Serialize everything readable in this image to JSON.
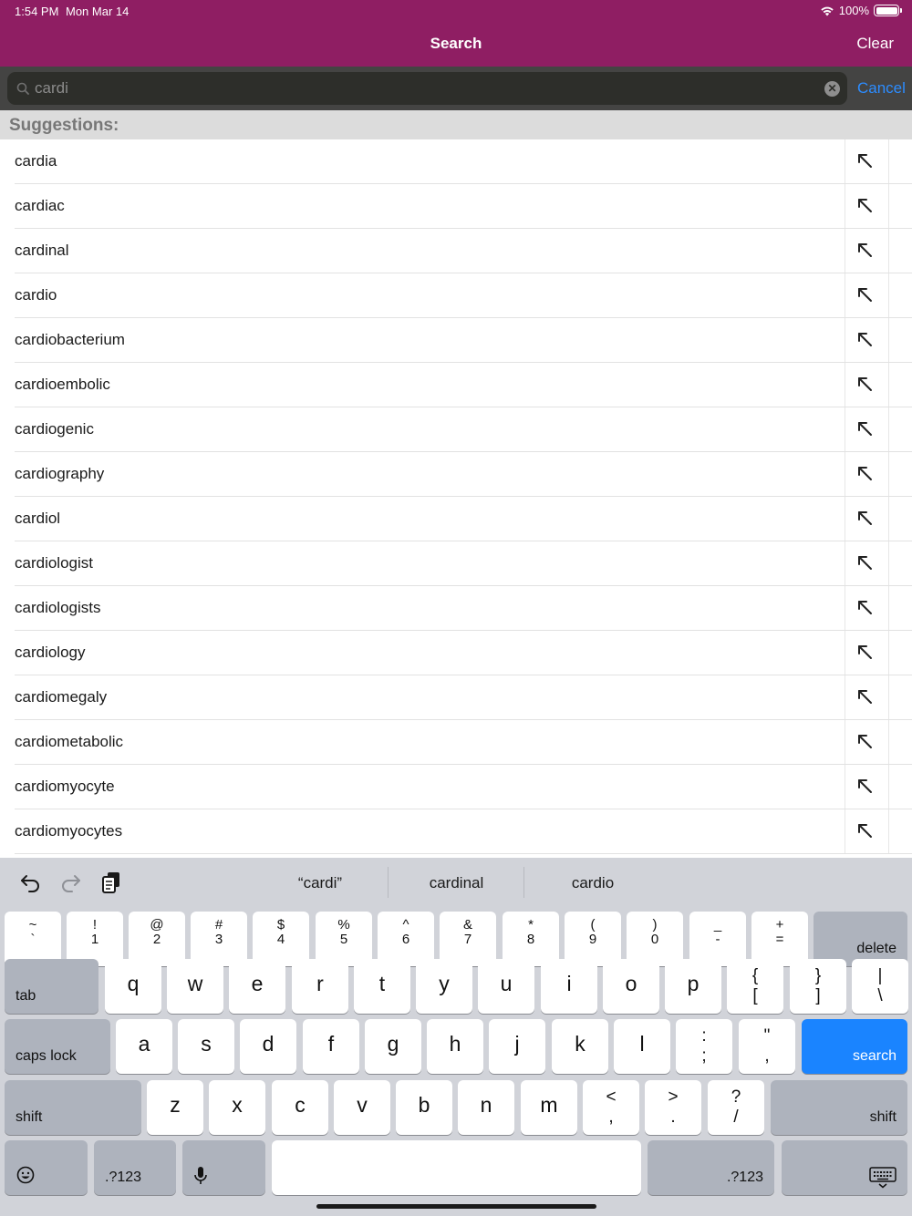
{
  "status": {
    "time": "1:54 PM",
    "date": "Mon Mar 14",
    "battery": "100%"
  },
  "nav": {
    "title": "Search",
    "clear_label": "Clear"
  },
  "search": {
    "value": "cardi",
    "cancel_label": "Cancel"
  },
  "suggestions": {
    "header": "Suggestions:",
    "items": [
      "cardia",
      "cardiac",
      "cardinal",
      "cardio",
      "cardiobacterium",
      "cardioembolic",
      "cardiogenic",
      "cardiography",
      "cardiol",
      "cardiologist",
      "cardiologists",
      "cardiology",
      "cardiomegaly",
      "cardiometabolic",
      "cardiomyocyte",
      "cardiomyocytes"
    ]
  },
  "keyboard": {
    "predictions": [
      "“cardi”",
      "cardinal",
      "cardio"
    ],
    "number_row": [
      {
        "top": "~",
        "bottom": "`"
      },
      {
        "top": "!",
        "bottom": "1"
      },
      {
        "top": "@",
        "bottom": "2"
      },
      {
        "top": "#",
        "bottom": "3"
      },
      {
        "top": "$",
        "bottom": "4"
      },
      {
        "top": "%",
        "bottom": "5"
      },
      {
        "top": "^",
        "bottom": "6"
      },
      {
        "top": "&",
        "bottom": "7"
      },
      {
        "top": "*",
        "bottom": "8"
      },
      {
        "top": "(",
        "bottom": "9"
      },
      {
        "top": ")",
        "bottom": "0"
      },
      {
        "top": "_",
        "bottom": "-"
      },
      {
        "top": "+",
        "bottom": "="
      }
    ],
    "delete_label": "delete",
    "tab_label": "tab",
    "row_q": [
      "q",
      "w",
      "e",
      "r",
      "t",
      "y",
      "u",
      "i",
      "o",
      "p"
    ],
    "row_q_symbols": [
      {
        "top": "{",
        "bottom": "["
      },
      {
        "top": "}",
        "bottom": "]"
      },
      {
        "top": "|",
        "bottom": "\\"
      }
    ],
    "caps_label": "caps lock",
    "row_a": [
      "a",
      "s",
      "d",
      "f",
      "g",
      "h",
      "j",
      "k",
      "l"
    ],
    "row_a_symbols": [
      {
        "top": ":",
        "bottom": ";"
      },
      {
        "top": "\"",
        "bottom": ","
      }
    ],
    "search_label": "search",
    "shift_label": "shift",
    "row_z": [
      "z",
      "x",
      "c",
      "v",
      "b",
      "n",
      "m"
    ],
    "row_z_symbols": [
      {
        "top": "<",
        "bottom": ","
      },
      {
        "top": ">",
        "bottom": "."
      },
      {
        "top": "?",
        "bottom": "/"
      }
    ],
    "numbers_label": ".?123"
  }
}
